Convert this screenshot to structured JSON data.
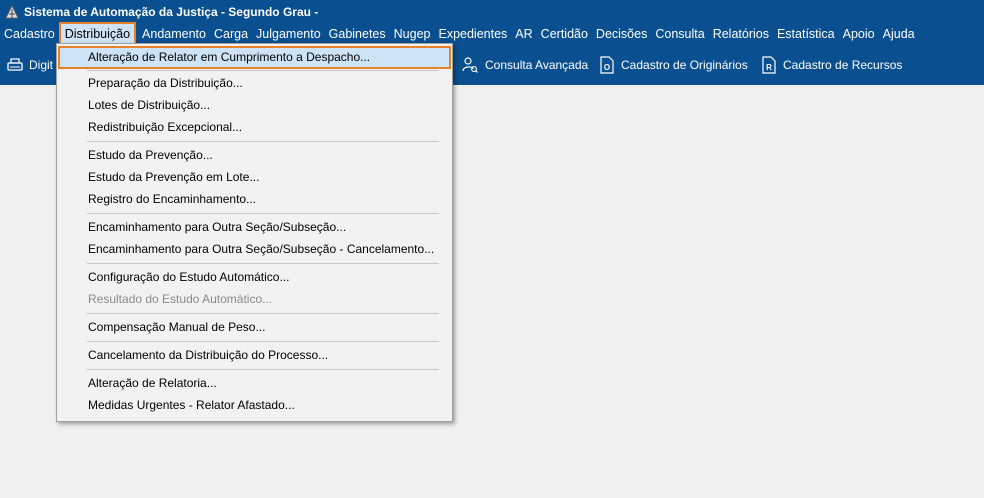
{
  "window": {
    "title": "Sistema de Automação da Justiça - Segundo Grau -"
  },
  "menubar": {
    "items": [
      {
        "label": "Cadastro"
      },
      {
        "label": "Distribuição"
      },
      {
        "label": "Andamento"
      },
      {
        "label": "Carga"
      },
      {
        "label": "Julgamento"
      },
      {
        "label": "Gabinetes"
      },
      {
        "label": "Nugep"
      },
      {
        "label": "Expedientes"
      },
      {
        "label": "AR"
      },
      {
        "label": "Certidão"
      },
      {
        "label": "Decisões"
      },
      {
        "label": "Consulta"
      },
      {
        "label": "Relatórios"
      },
      {
        "label": "Estatística"
      },
      {
        "label": "Apoio"
      },
      {
        "label": "Ajuda"
      }
    ]
  },
  "toolbar": {
    "digit_label": "Digit",
    "consulta_label": "Consulta Avançada",
    "originarios_label": "Cadastro de Originários",
    "recursos_label": "Cadastro de Recursos",
    "originarios_icon": "O",
    "recursos_icon": "R"
  },
  "dropdown": {
    "items": [
      {
        "label": "Alteração de Relator em Cumprimento a Despacho..."
      },
      {
        "label": "Preparação da Distribuição..."
      },
      {
        "label": "Lotes de Distribuição..."
      },
      {
        "label": "Redistribuição Excepcional..."
      },
      {
        "label": "Estudo da Prevenção..."
      },
      {
        "label": "Estudo da Prevenção em Lote..."
      },
      {
        "label": "Registro do Encaminhamento..."
      },
      {
        "label": "Encaminhamento para Outra Seção/Subseção..."
      },
      {
        "label": "Encaminhamento para Outra Seção/Subseção - Cancelamento..."
      },
      {
        "label": "Configuração do Estudo Automático..."
      },
      {
        "label": "Resultado do Estudo Automático..."
      },
      {
        "label": "Compensação Manual de Peso..."
      },
      {
        "label": "Cancelamento da Distribuição do Processo..."
      },
      {
        "label": "Alteração de Relatoria..."
      },
      {
        "label": "Medidas Urgentes - Relator Afastado..."
      }
    ]
  },
  "colors": {
    "title_bg": "#0a4f8f",
    "highlight_bg": "#cfe3f7",
    "accent_outline": "#e8822a"
  }
}
